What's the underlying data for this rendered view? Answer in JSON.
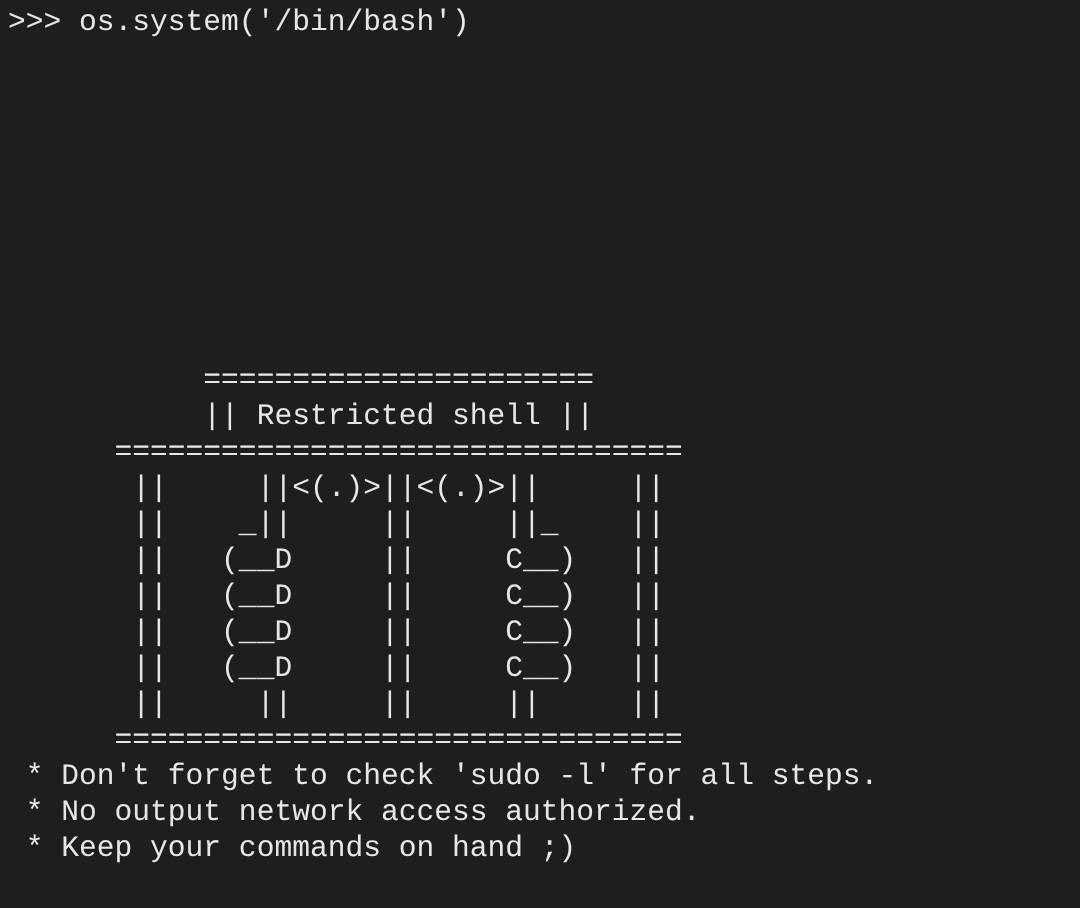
{
  "command": ">>> os.system('/bin/bash')",
  "banner": [
    "           ======================",
    "           || Restricted shell ||",
    "      ================================",
    "       ||     ||<(.)>||<(.)>||     ||",
    "       ||    _||     ||     ||_    ||",
    "       ||   (__D     ||     C__)   ||",
    "       ||   (__D     ||     C__)   ||",
    "       ||   (__D     ||     C__)   ||",
    "       ||   (__D     ||     C__)   ||",
    "       ||     ||     ||     ||     ||",
    "      ================================"
  ],
  "notes": [
    " * Don't forget to check 'sudo -l' for all steps.",
    " * No output network access authorized.",
    " * Keep your commands on hand ;)"
  ]
}
